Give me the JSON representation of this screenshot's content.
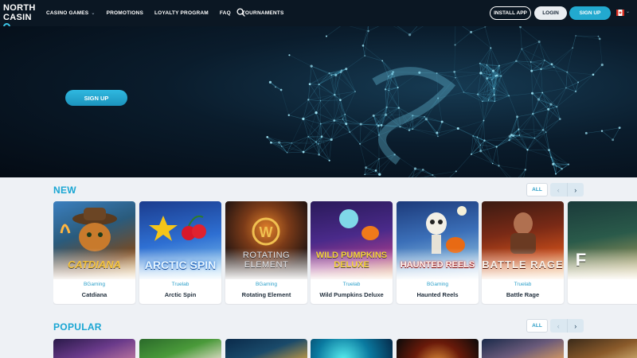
{
  "header": {
    "logo_top": "NORTH",
    "logo_bottom": "CASIN",
    "nav": [
      {
        "label": "CASINO GAMES",
        "has_dropdown": true
      },
      {
        "label": "PROMOTIONS"
      },
      {
        "label": "LOYALTY PROGRAM"
      },
      {
        "label": "FAQ"
      },
      {
        "label": "TOURNAMENTS"
      }
    ],
    "install_label": "INSTALL APP",
    "login_label": "LOGIN",
    "signup_label": "SIGN UP",
    "flag_icon": "canada-flag-icon"
  },
  "hero": {
    "signup_label": "SIGN UP"
  },
  "sections": {
    "new": {
      "title": "NEW",
      "all_label": "ALL",
      "games": [
        {
          "art": "CATDIANA",
          "provider": "BGaming",
          "name": "Catdiana"
        },
        {
          "art": "ARCTIC SPIN",
          "provider": "Truelab",
          "name": "Arctic Spin"
        },
        {
          "art": "ROTATING ELEMENT",
          "provider": "BGaming",
          "name": "Rotating Element"
        },
        {
          "art": "WILD PUMPKINS DELUXE",
          "provider": "Truelab",
          "name": "Wild Pumpkins Deluxe"
        },
        {
          "art": "HAUNTED REELS",
          "provider": "BGaming",
          "name": "Haunted Reels"
        },
        {
          "art": "BATTLE RAGE",
          "provider": "Truelab",
          "name": "Battle Rage"
        },
        {
          "art": "F",
          "provider": "",
          "name": ""
        }
      ]
    },
    "popular": {
      "title": "POPULAR",
      "all_label": "ALL"
    }
  },
  "colors": {
    "accent": "#1aa6d3",
    "header_bg": "#0b1723",
    "page_bg": "#eef1f5"
  }
}
